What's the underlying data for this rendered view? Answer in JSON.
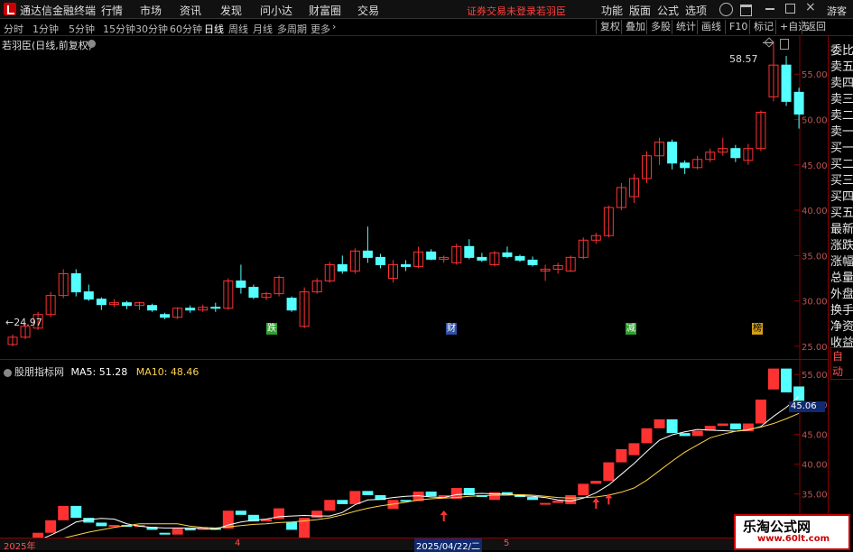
{
  "app_title": "通达信金融终端",
  "menu": [
    "行情",
    "市场",
    "资讯",
    "发现",
    "问小达",
    "财富圈",
    "交易"
  ],
  "login_status": "证券交易未登录",
  "stock_name": "若羽臣",
  "top_right_menu": [
    "功能",
    "版面",
    "公式",
    "选项",
    "游客"
  ],
  "periods": [
    "分时",
    "1分钟",
    "5分钟",
    "15分钟",
    "30分钟",
    "60分钟",
    "日线",
    "周线",
    "月线",
    "多周期",
    "更多"
  ],
  "active_period": "日线",
  "chart_buttons": [
    "复权",
    "叠加",
    "多股",
    "统计",
    "画线",
    "F10",
    "标记",
    "+自选",
    "返回"
  ],
  "main_title": "若羽臣(日线,前复权)",
  "right_panel": [
    "委比",
    "卖五",
    "卖四",
    "卖三",
    "卖二",
    "卖一",
    "买一",
    "买二",
    "买三",
    "买四",
    "买五",
    "最新",
    "涨跌",
    "涨幅",
    "总量",
    "外盘",
    "换手",
    "净资",
    "收益"
  ],
  "auto_label": "自动",
  "indicator": {
    "name": "股朋指标网",
    "ma5_label": "MA5: 51.28",
    "ma10_label": "MA10: 48.46",
    "current": "45.06"
  },
  "annotations": {
    "high": "58.57",
    "low": "24.97"
  },
  "event_marks": [
    "跌",
    "财",
    "减",
    "榜"
  ],
  "x_axis_labels": [
    "2025年",
    "4",
    "2025/04/22/二",
    "5"
  ],
  "watermark": {
    "line1": "乐淘公式网",
    "line2": "www.60lt.com"
  },
  "colors": {
    "up": "#ff3232",
    "down": "#54ffff",
    "ma5": "#ffffff",
    "ma10": "#ffd24a",
    "axis": "#8b0000"
  },
  "chart_data": {
    "type": "candlestick",
    "title": "若羽臣(日线,前复权)",
    "ylim": [
      24,
      59
    ],
    "yticks": [
      25,
      30,
      35,
      40,
      45,
      50,
      55
    ],
    "candles": [
      [
        25.2,
        26.3,
        25.0,
        26.0
      ],
      [
        26.0,
        27.5,
        25.8,
        27.2
      ],
      [
        27.0,
        28.8,
        26.8,
        28.5
      ],
      [
        28.5,
        31.0,
        28.2,
        30.6
      ],
      [
        30.6,
        33.5,
        30.3,
        33.0
      ],
      [
        33.0,
        33.5,
        30.5,
        31.0
      ],
      [
        31.0,
        31.8,
        30.0,
        30.2
      ],
      [
        30.2,
        30.4,
        29.0,
        29.6
      ],
      [
        29.6,
        30.2,
        29.3,
        29.8
      ],
      [
        29.8,
        30.0,
        29.1,
        29.5
      ],
      [
        29.5,
        29.9,
        29.0,
        29.8
      ],
      [
        29.5,
        29.7,
        28.8,
        29.0
      ],
      [
        28.5,
        28.7,
        28.0,
        28.2
      ],
      [
        28.2,
        29.3,
        28.0,
        29.2
      ],
      [
        29.2,
        29.5,
        28.7,
        29.0
      ],
      [
        29.0,
        29.6,
        28.8,
        29.3
      ],
      [
        29.3,
        29.8,
        28.8,
        29.2
      ],
      [
        29.2,
        32.5,
        29.0,
        32.2
      ],
      [
        32.2,
        34.0,
        30.8,
        31.5
      ],
      [
        31.5,
        31.8,
        30.2,
        30.4
      ],
      [
        30.4,
        31.0,
        30.1,
        30.8
      ],
      [
        30.8,
        32.8,
        30.5,
        32.6
      ],
      [
        30.3,
        30.5,
        28.8,
        29.0
      ],
      [
        27.2,
        31.5,
        27.0,
        31.0
      ],
      [
        31.0,
        32.5,
        30.8,
        32.2
      ],
      [
        32.2,
        34.3,
        32.0,
        34.0
      ],
      [
        34.0,
        35.0,
        33.0,
        33.3
      ],
      [
        33.3,
        35.8,
        33.0,
        35.5
      ],
      [
        35.5,
        38.2,
        34.2,
        34.8
      ],
      [
        34.8,
        35.2,
        33.6,
        34.0
      ],
      [
        32.5,
        34.5,
        32.0,
        34.0
      ],
      [
        34.0,
        34.5,
        33.3,
        33.8
      ],
      [
        33.8,
        36.0,
        33.6,
        35.4
      ],
      [
        35.4,
        35.7,
        34.5,
        34.6
      ],
      [
        34.6,
        35.0,
        34.2,
        34.8
      ],
      [
        34.2,
        36.3,
        34.0,
        36.0
      ],
      [
        36.0,
        36.8,
        34.6,
        34.8
      ],
      [
        34.8,
        35.3,
        34.3,
        34.5
      ],
      [
        34.0,
        35.5,
        33.8,
        35.3
      ],
      [
        35.3,
        36.0,
        34.7,
        34.9
      ],
      [
        34.9,
        35.1,
        34.3,
        34.5
      ],
      [
        34.5,
        34.9,
        33.8,
        34.0
      ],
      [
        33.3,
        34.0,
        32.2,
        33.5
      ],
      [
        33.5,
        34.2,
        33.0,
        33.9
      ],
      [
        33.3,
        35.0,
        33.2,
        34.8
      ],
      [
        34.8,
        37.0,
        34.6,
        36.7
      ],
      [
        36.7,
        37.5,
        36.3,
        37.2
      ],
      [
        37.2,
        40.5,
        37.0,
        40.3
      ],
      [
        40.3,
        43.0,
        40.0,
        42.5
      ],
      [
        41.5,
        44.0,
        40.8,
        43.5
      ],
      [
        43.5,
        46.5,
        43.0,
        46.0
      ],
      [
        46.0,
        48.0,
        45.0,
        47.5
      ],
      [
        47.5,
        47.8,
        44.5,
        45.2
      ],
      [
        45.2,
        45.5,
        44.0,
        44.7
      ],
      [
        44.7,
        46.0,
        44.5,
        45.6
      ],
      [
        45.6,
        46.8,
        45.3,
        46.4
      ],
      [
        46.4,
        48.0,
        46.0,
        46.8
      ],
      [
        46.8,
        47.2,
        45.3,
        45.8
      ],
      [
        45.5,
        47.3,
        45.0,
        46.8
      ],
      [
        46.8,
        51.0,
        46.5,
        50.8
      ],
      [
        52.5,
        58.6,
        52.0,
        56.0
      ],
      [
        56.0,
        57.0,
        51.5,
        52.0
      ],
      [
        53.0,
        53.5,
        49.0,
        50.6
      ]
    ],
    "ma5": [
      25.9,
      26.6,
      27.2,
      28.1,
      29.1,
      30.3,
      30.7,
      30.9,
      30.8,
      30.0,
      29.6,
      29.4,
      29.3,
      29.3,
      29.3,
      29.2,
      29.1,
      29.8,
      30.3,
      30.6,
      30.8,
      31.2,
      31.3,
      31.4,
      31.3,
      31.3,
      31.9,
      33.2,
      34.0,
      34.1,
      34.4,
      34.6,
      34.7,
      34.5,
      34.4,
      34.9,
      35.0,
      35.1,
      35.0,
      35.0,
      34.7,
      34.6,
      34.4,
      34.0,
      33.8,
      34.3,
      35.2,
      36.5,
      38.3,
      40.1,
      42.1,
      44.0,
      44.9,
      45.4,
      45.8,
      45.7,
      45.6,
      45.5,
      45.7,
      46.3,
      48.0,
      49.5,
      51.3
    ],
    "ma10": [
      25.8,
      26.2,
      26.6,
      27.0,
      27.6,
      28.1,
      28.6,
      29.0,
      29.4,
      29.7,
      30.0,
      30.0,
      30.0,
      30.0,
      29.6,
      29.4,
      29.3,
      29.5,
      29.7,
      29.9,
      30.0,
      30.2,
      30.3,
      30.5,
      30.7,
      31.0,
      31.5,
      32.1,
      32.6,
      33.0,
      33.3,
      33.6,
      34.0,
      34.2,
      34.3,
      34.4,
      34.6,
      34.7,
      34.8,
      34.8,
      34.9,
      34.8,
      34.6,
      34.4,
      34.3,
      34.4,
      34.5,
      34.8,
      35.3,
      36.0,
      37.3,
      38.9,
      40.5,
      42.0,
      43.2,
      44.4,
      45.0,
      45.5,
      45.8,
      46.2,
      46.8,
      47.6,
      48.5
    ],
    "sub_ylim": [
      28,
      57
    ],
    "sub_yticks": [
      30,
      35,
      40,
      45,
      50,
      55
    ],
    "signal_arrows_at": [
      16,
      34,
      46,
      47
    ]
  }
}
